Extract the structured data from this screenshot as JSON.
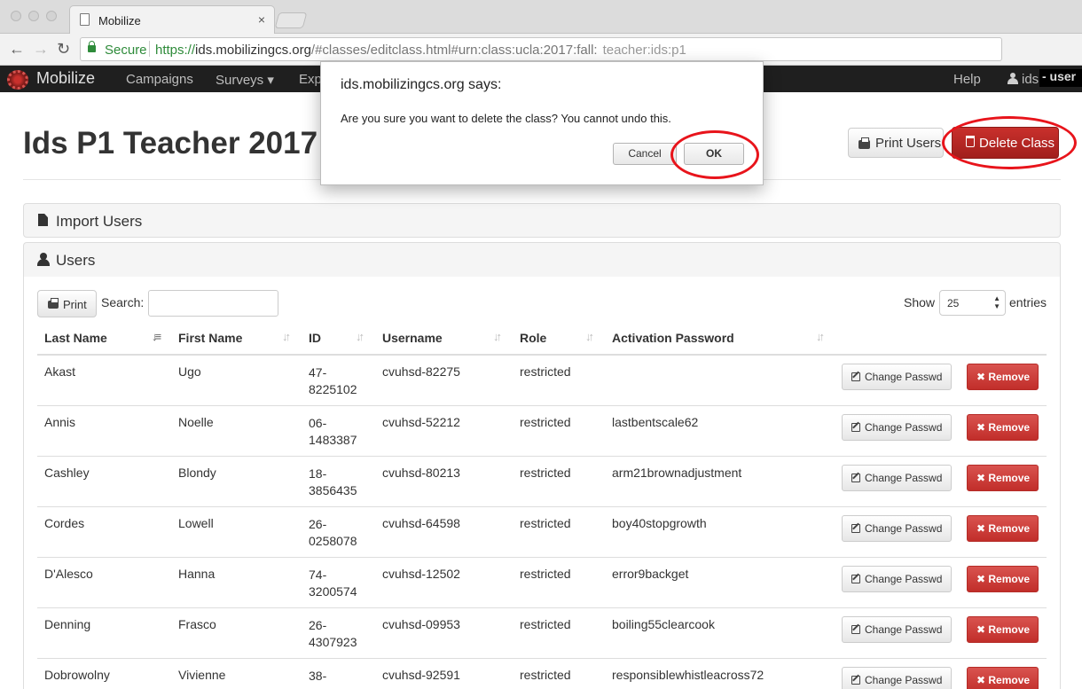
{
  "browser": {
    "tab_title": "Mobilize",
    "tab_close": "×",
    "secure_label": "Secure",
    "url_scheme": "https://",
    "url_host": "ids.mobilizingcs.org",
    "url_path": "/#classes/editclass.html#urn:class:ucla:2017:fall:",
    "url_tail": "teacher:ids:p1",
    "back_glyph": "←",
    "forward_glyph": "→",
    "reload_glyph": "↻"
  },
  "navbar": {
    "brand": "Mobilize",
    "items": [
      "Campaigns",
      "Surveys ▾",
      "Exp"
    ],
    "help": "Help",
    "user_name": "ids",
    "user_tag": "- user"
  },
  "page": {
    "title": "Ids P1 Teacher 2017",
    "print_users_label": "Print Users",
    "delete_class_label": "Delete Class"
  },
  "panels": {
    "import_title": "Import Users",
    "users_title": "Users"
  },
  "table_controls": {
    "print_label": "Print",
    "search_label": "Search:",
    "search_value": "",
    "show_label": "Show",
    "entries_value": "25",
    "entries_label": "entries"
  },
  "table": {
    "columns": [
      "Last Name",
      "First Name",
      "ID",
      "Username",
      "Role",
      "Activation Password"
    ],
    "change_passwd_label": "Change Passwd",
    "remove_label": "✖ Remove",
    "rows": [
      {
        "last": "Akast",
        "first": "Ugo",
        "id1": "47-",
        "id2": "8225102",
        "username": "cvuhsd-82275",
        "role": "restricted",
        "password": ""
      },
      {
        "last": "Annis",
        "first": "Noelle",
        "id1": "06-",
        "id2": "1483387",
        "username": "cvuhsd-52212",
        "role": "restricted",
        "password": "lastbentscale62"
      },
      {
        "last": "Cashley",
        "first": "Blondy",
        "id1": "18-",
        "id2": "3856435",
        "username": "cvuhsd-80213",
        "role": "restricted",
        "password": "arm21brownadjustment"
      },
      {
        "last": "Cordes",
        "first": "Lowell",
        "id1": "26-",
        "id2": "0258078",
        "username": "cvuhsd-64598",
        "role": "restricted",
        "password": "boy40stopgrowth"
      },
      {
        "last": "D'Alesco",
        "first": "Hanna",
        "id1": "74-",
        "id2": "3200574",
        "username": "cvuhsd-12502",
        "role": "restricted",
        "password": "error9backget"
      },
      {
        "last": "Denning",
        "first": "Frasco",
        "id1": "26-",
        "id2": "4307923",
        "username": "cvuhsd-09953",
        "role": "restricted",
        "password": "boiling55clearcook"
      },
      {
        "last": "Dobrowolny",
        "first": "Vivienne",
        "id1": "38-",
        "id2": "",
        "username": "cvuhsd-92591",
        "role": "restricted",
        "password": "responsiblewhistleacross72"
      }
    ]
  },
  "dialog": {
    "title": "ids.mobilizingcs.org says:",
    "message": "Are you sure you want to delete the class? You cannot undo this.",
    "cancel_label": "Cancel",
    "ok_label": "OK"
  },
  "colors": {
    "danger": "#c9302c",
    "callout": "#e8141b",
    "navbar": "#1f1f1f",
    "secure_green": "#2e8b3a"
  }
}
